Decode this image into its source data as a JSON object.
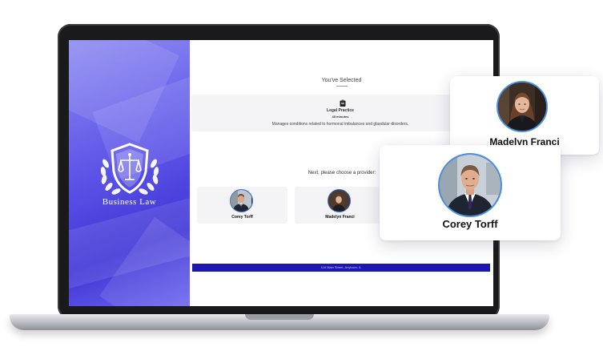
{
  "brand": {
    "name": "Business Law",
    "logo_icon": "shield-scales-laurel-icon"
  },
  "selection": {
    "heading": "You've Selected",
    "service": {
      "icon": "clipboard-icon",
      "title": "Legal Practice",
      "duration": "45 minutes",
      "description": "Manages conditions related to hormonal imbalances and glandular disorders."
    }
  },
  "providers_section": {
    "heading": "Next, please choose a provider:",
    "providers": [
      {
        "name": "Corey Torff"
      },
      {
        "name": "Madelyn Franci"
      }
    ]
  },
  "footer": {
    "address": "116 Main Street, Anytown, IL"
  },
  "floating_cards": {
    "madelyn": {
      "name": "Madelyn Franci"
    },
    "corey": {
      "name": "Corey Torff"
    }
  },
  "colors": {
    "brand_gradient_start": "#8f8cf2",
    "brand_gradient_end": "#3f35d6",
    "footer_bar": "#1d16b3",
    "avatar_ring": "#4a90e2"
  }
}
